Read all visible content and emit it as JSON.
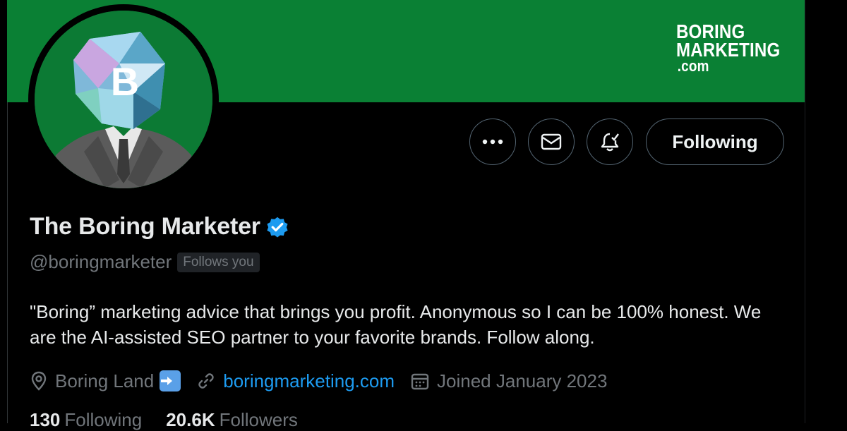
{
  "profile": {
    "display_name": "The Boring Marketer",
    "handle": "@boringmarketer",
    "follows_you_badge": "Follows you",
    "bio": "\"Boring” marketing advice that brings you profit. Anonymous so I can be 100% honest. We are the AI-assisted SEO partner to your favorite brands. Follow along.",
    "location": "Boring Land",
    "website": "boringmarketing.com",
    "joined": "Joined January 2023",
    "following_count": "130",
    "following_label": "Following",
    "followers_count": "20.6K",
    "followers_label": "Followers"
  },
  "banner": {
    "brand_line1": "BORING",
    "brand_line2": "MARKETING",
    "brand_line3": ".com",
    "color": "#0a8034"
  },
  "actions": {
    "follow_button_label": "Following",
    "more_icon": "more-dots-icon",
    "message_icon": "envelope-icon",
    "notify_icon": "bell-check-icon"
  },
  "avatar": {
    "letter": "B"
  },
  "colors": {
    "background": "#000000",
    "accent": "#1d9bf0",
    "muted": "#71767b",
    "text": "#e7e9ea"
  }
}
